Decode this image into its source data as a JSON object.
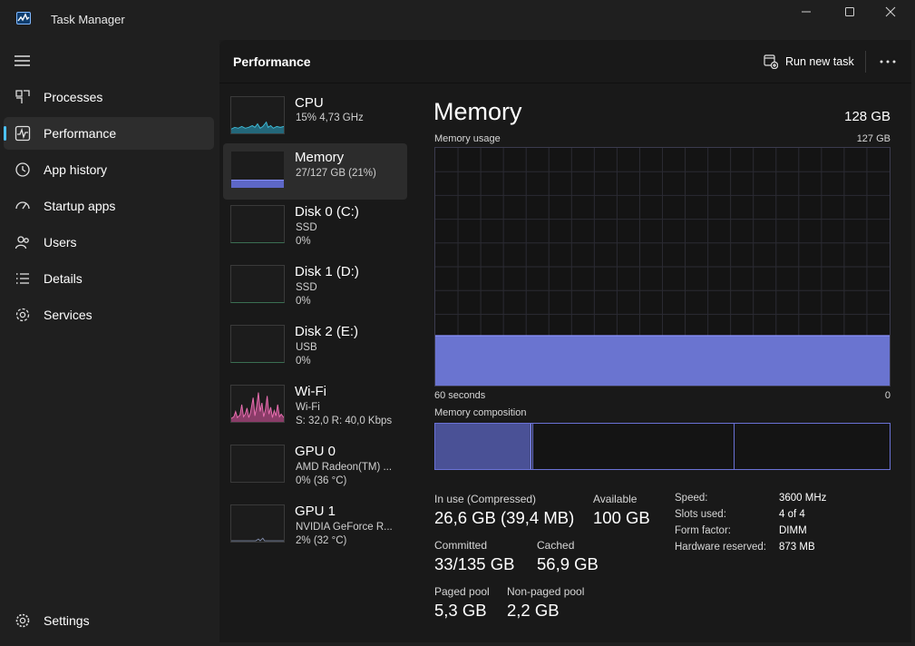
{
  "window": {
    "title": "Task Manager"
  },
  "sidebar": {
    "items": [
      {
        "label": "Processes",
        "icon": "processes-icon"
      },
      {
        "label": "Performance",
        "icon": "performance-icon",
        "active": true
      },
      {
        "label": "App history",
        "icon": "app-history-icon"
      },
      {
        "label": "Startup apps",
        "icon": "startup-apps-icon"
      },
      {
        "label": "Users",
        "icon": "users-icon"
      },
      {
        "label": "Details",
        "icon": "details-icon"
      },
      {
        "label": "Services",
        "icon": "services-icon"
      }
    ],
    "settings_label": "Settings"
  },
  "header": {
    "title": "Performance",
    "run_task_label": "Run new task"
  },
  "devices": [
    {
      "name": "CPU",
      "line1": "15% 4,73 GHz",
      "line2": ""
    },
    {
      "name": "Memory",
      "line1": "27/127 GB (21%)",
      "line2": ""
    },
    {
      "name": "Disk 0 (C:)",
      "line1": "SSD",
      "line2": "0%"
    },
    {
      "name": "Disk 1 (D:)",
      "line1": "SSD",
      "line2": "0%"
    },
    {
      "name": "Disk 2 (E:)",
      "line1": "USB",
      "line2": "0%"
    },
    {
      "name": "Wi-Fi",
      "line1": "Wi-Fi",
      "line2": "S: 32,0  R: 40,0 Kbps"
    },
    {
      "name": "GPU 0",
      "line1": "AMD Radeon(TM) ...",
      "line2": "0% (36 °C)"
    },
    {
      "name": "GPU 1",
      "line1": "NVIDIA GeForce R...",
      "line2": "2% (32 °C)"
    }
  ],
  "memory": {
    "title": "Memory",
    "total": "128 GB",
    "usage_label": "Memory usage",
    "usage_max": "127 GB",
    "time_left": "60 seconds",
    "time_right": "0",
    "composition_label": "Memory composition",
    "usage_fraction": 0.21,
    "in_use_label": "In use (Compressed)",
    "in_use_value": "26,6 GB (39,4 MB)",
    "available_label": "Available",
    "available_value": "100 GB",
    "committed_label": "Committed",
    "committed_value": "33/135 GB",
    "cached_label": "Cached",
    "cached_value": "56,9 GB",
    "paged_label": "Paged pool",
    "paged_value": "5,3 GB",
    "nonpaged_label": "Non-paged pool",
    "nonpaged_value": "2,2 GB",
    "specs": [
      {
        "label": "Speed:",
        "value": "3600 MHz"
      },
      {
        "label": "Slots used:",
        "value": "4 of 4"
      },
      {
        "label": "Form factor:",
        "value": "DIMM"
      },
      {
        "label": "Hardware reserved:",
        "value": "873 MB"
      }
    ]
  },
  "colors": {
    "accent": "#4cc2ff",
    "memory": "#6a74d0",
    "cpu": "#3dbad6",
    "wifi": "#e86fb0"
  }
}
